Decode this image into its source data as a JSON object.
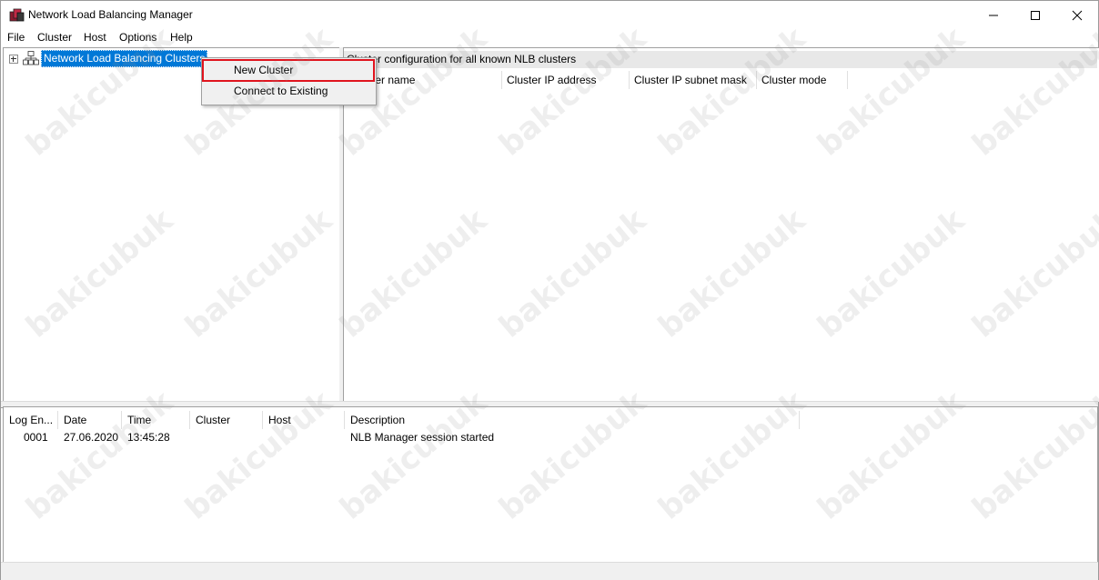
{
  "window": {
    "title": "Network Load Balancing Manager",
    "minimize_glyph": "—",
    "maximize_glyph": "☐",
    "close_glyph": "✕"
  },
  "menu": [
    "File",
    "Cluster",
    "Host",
    "Options",
    "Help"
  ],
  "tree": {
    "root_label": "Network Load Balancing Clusters",
    "icon": "network-cluster-icon"
  },
  "context_menu": {
    "items": [
      "New Cluster",
      "Connect to Existing"
    ],
    "highlighted": "New Cluster",
    "highlight_color": "#e0141e"
  },
  "right_pane": {
    "header": "Cluster configuration for all known NLB clusters",
    "columns": [
      "Cluster name",
      "Cluster IP address",
      "Cluster IP subnet mask",
      "Cluster mode"
    ]
  },
  "log": {
    "columns": [
      "Log En...",
      "Date",
      "Time",
      "Cluster",
      "Host",
      "Description"
    ],
    "rows": [
      {
        "entry": "0001",
        "date": "27.06.2020",
        "time": "13:45:28",
        "cluster": "",
        "host": "",
        "description": "NLB Manager session started"
      }
    ]
  },
  "watermark": "bakicubuk",
  "colors": {
    "selection": "#0078d7",
    "highlight_border": "#e0141e"
  }
}
